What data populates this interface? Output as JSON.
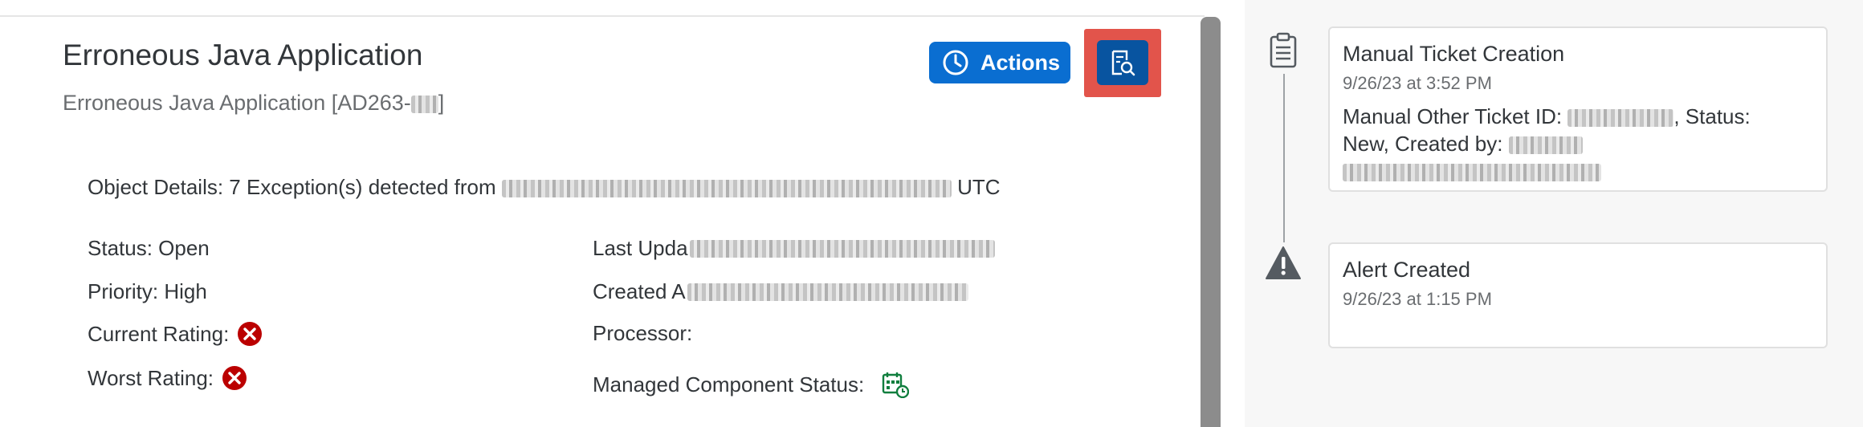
{
  "header": {
    "title": "Erroneous Java Application",
    "subtitle": "Erroneous Java Application [AD263-",
    "subtitle_end": "]",
    "actions_label": "Actions"
  },
  "object_details": {
    "prefix": "Object Details: 7 Exception(s) detected from",
    "suffix": "UTC"
  },
  "fields": {
    "status": "Status: Open",
    "priority": "Priority: High",
    "current_rating": "Current Rating:",
    "worst_rating": "Worst Rating:",
    "last_updated": "Last Upda",
    "created_at": "Created A",
    "processor": "Processor:",
    "managed_component_status": "Managed Component Status:"
  },
  "timeline": [
    {
      "icon": "clipboard-icon",
      "title": "Manual Ticket Creation",
      "date": "9/26/23 at 3:52 PM",
      "body_line1_a": "Manual Other Ticket ID:",
      "body_line1_b": ", Status:",
      "body_line2": "New, Created by:"
    },
    {
      "icon": "warning-icon",
      "title": "Alert Created",
      "date": "9/26/23 at 1:15 PM"
    }
  ],
  "colors": {
    "accent": "#0a6ed1",
    "accent_dark": "#0854a0",
    "error": "#bb0000",
    "success": "#107e3e",
    "highlight": "#e2544b"
  }
}
